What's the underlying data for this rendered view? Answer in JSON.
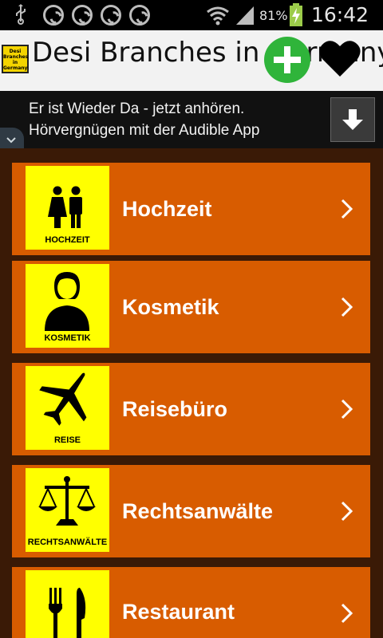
{
  "status_bar": {
    "battery_percent": "81%",
    "time": "16:42",
    "notification_icons": [
      "usb-icon",
      "shazam-icon",
      "shazam-icon",
      "shazam-icon",
      "shazam-icon"
    ]
  },
  "header": {
    "title": "Desi Branches in Germany",
    "logo_text": "Desi Branches in Germany",
    "add_icon": "plus-circle-icon",
    "favorite_icon": "heart-icon"
  },
  "ad": {
    "line1": "Er ist Wieder Da - jetzt anhören.",
    "line2": "Hörvergnügen mit der Audible App"
  },
  "categories": [
    {
      "label": "Hochzeit",
      "tile_label": "HOCHZEIT",
      "icon": "couple-icon"
    },
    {
      "label": "Kosmetik",
      "tile_label": "KOSMETIK",
      "icon": "woman-icon"
    },
    {
      "label": "Reisebüro",
      "tile_label": "REISE",
      "icon": "airplane-icon"
    },
    {
      "label": "Rechtsanwälte",
      "tile_label": "RECHTSANWÄLTE",
      "icon": "scales-icon"
    },
    {
      "label": "Restaurant",
      "tile_label": "",
      "icon": "cutlery-icon"
    }
  ],
  "colors": {
    "item_background": "#d85c00",
    "tile_background": "#ffff00",
    "list_background": "#3a1a06",
    "add_button": "#2fb43a"
  }
}
